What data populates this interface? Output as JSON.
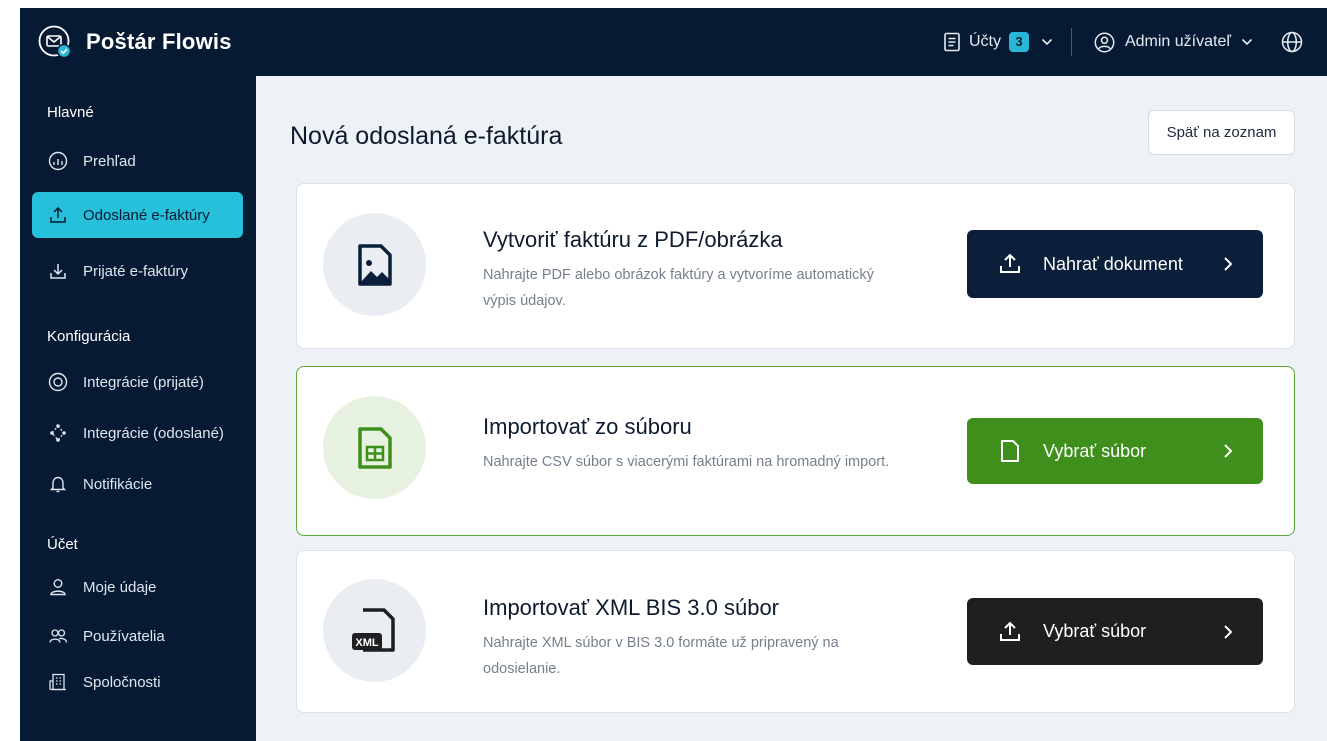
{
  "app": {
    "name": "Poštár Flowis"
  },
  "topbar": {
    "accounts_label": "Účty",
    "accounts_count": "3",
    "user_label": "Admin užívateľ"
  },
  "sidebar": {
    "sections": [
      {
        "label": "Hlavné"
      },
      {
        "label": "Konfigurácia"
      },
      {
        "label": "Účet"
      }
    ],
    "items": [
      {
        "label": "Prehľad",
        "icon": "dashboard-icon"
      },
      {
        "label": "Odoslané e-faktúry",
        "icon": "upload-icon",
        "active": true
      },
      {
        "label": "Prijaté e-faktúry",
        "icon": "download-icon"
      },
      {
        "label": "Integrácie (prijaté)",
        "icon": "integration-icon"
      },
      {
        "label": "Integrácie (odoslané)",
        "icon": "network-icon"
      },
      {
        "label": "Notifikácie",
        "icon": "bell-icon"
      },
      {
        "label": "Moje údaje",
        "icon": "user-icon"
      },
      {
        "label": "Používatelia",
        "icon": "users-icon"
      },
      {
        "label": "Spoločnosti",
        "icon": "building-icon"
      }
    ]
  },
  "main": {
    "title": "Nová odoslaná e-faktúra",
    "back_label": "Späť na zoznam",
    "cards": [
      {
        "title": "Vytvoriť faktúru z PDF/obrázka",
        "description": "Nahrajte PDF alebo obrázok faktúry a vytvoríme automatický výpis údajov.",
        "button_label": "Nahrať dokument",
        "icon": "image-file-icon"
      },
      {
        "title": "Importovať zo súboru",
        "description": "Nahrajte CSV súbor s viacerými faktúrami na hromadný import.",
        "button_label": "Vybrať súbor",
        "icon": "spreadsheet-file-icon"
      },
      {
        "title": "Importovať XML BIS 3.0 súbor",
        "description": "Nahrajte XML súbor v BIS 3.0 formáte už pripravený na odosielanie.",
        "button_label": "Vybrať súbor",
        "icon": "xml-file-icon",
        "icon_text": "XML"
      }
    ]
  },
  "colors": {
    "navy": "#071a33",
    "accent": "#26c0da",
    "green": "#3f8f1d",
    "black": "#1e1f21"
  }
}
